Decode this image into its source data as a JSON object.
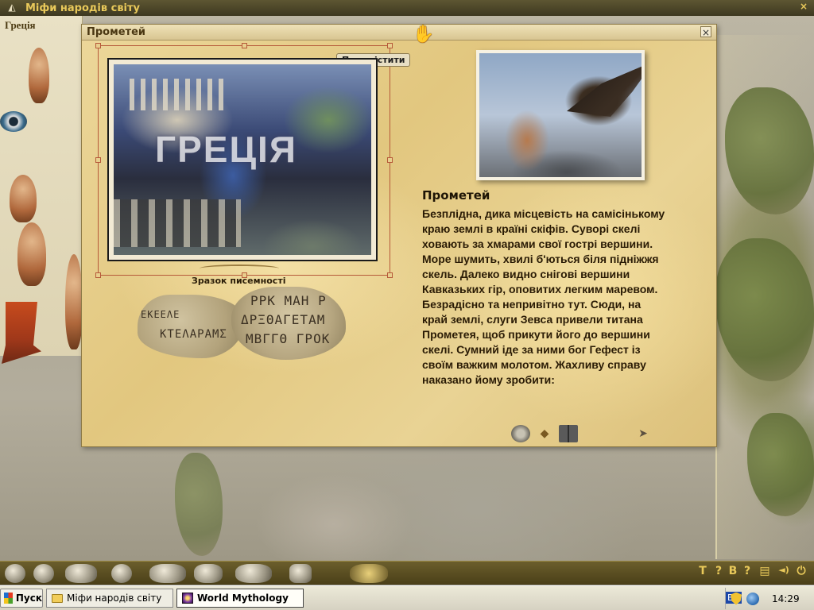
{
  "app": {
    "title": "Міфи народів світу",
    "close_glyph": "×",
    "country": "Греція"
  },
  "dialog": {
    "title": "Прометей",
    "close_glyph": "×",
    "move_button": "Перемістити",
    "photo_caption": "ГРЕЦІЯ",
    "sample_label": "Зразок писемності",
    "runes": {
      "left_line1": "ΚΤΕΛΑΡΑΜΣ",
      "left_line2": "ΕΚΕΕΛΕ",
      "right_line1": "ΡΡΚ ΜΑΗ Ρ",
      "right_line2": "ΔΡΞΘΑΓΕΤΑΜ",
      "right_line3": "ΜΒΓΓΘ ΓΡΟΚ"
    },
    "article_title": "Прометей",
    "article_text": " Безплідна, дика місцевість на самісінькому краю землі в країні скіфів. Суворі скелі ховають за хмарами свої гострі вершини. Море шумить, хвилі б'ються біля підніжжя скель. Далеко видно снігові вершини Кавказьких гір, оповитих легким маревом. Безрадісно та непривітно тут. Сюди, на край землі, слуги Зевса привели титана Прометея, щоб прикути його до вершини скелі. Сумний іде за ними бог Гефест із своїм важким молотом. Жахливу справу наказано йому зробити:"
  },
  "bottom_toolbar": {
    "right_glyphs": [
      "T",
      "?",
      "B",
      "?",
      "▤",
      "◄)",
      "⏻"
    ]
  },
  "taskbar": {
    "start_label": "Пуск",
    "tasks": [
      {
        "label": "Міфи народів світу",
        "active": false
      },
      {
        "label": "World Mythology",
        "active": true
      }
    ],
    "language": "EN",
    "clock": "14:29"
  }
}
